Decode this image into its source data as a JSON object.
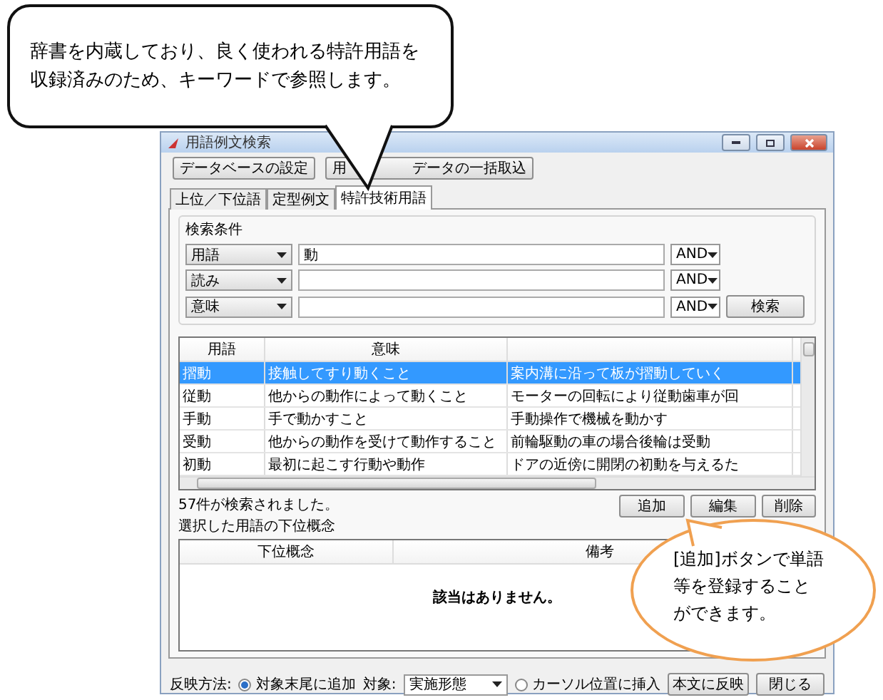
{
  "callouts": [
    {
      "kind": "speech",
      "lines": [
        "辞書を内蔵しており、良く使われる特許用語を",
        "収録済みのため、キーワードで参照します。"
      ]
    },
    {
      "kind": "bubble",
      "lines": [
        "[追加]ボタンで単語",
        "等を登録すること",
        "ができます。"
      ]
    }
  ],
  "window": {
    "title": "用語例文検索"
  },
  "toolbar": [
    {
      "parts": [
        "データベースの設定"
      ]
    },
    {
      "parts": [
        "用",
        "データの一括取込"
      ]
    }
  ],
  "tabs": [
    {
      "label": "上位／下位語",
      "selected": false
    },
    {
      "label": "定型例文",
      "selected": false
    },
    {
      "label": "特許技術用語",
      "selected": true
    }
  ],
  "search": {
    "title": "検索条件",
    "button": "検索",
    "rows": [
      {
        "field": "用語",
        "value": "動",
        "operator": "AND"
      },
      {
        "field": "読み",
        "value": "",
        "operator": "AND"
      },
      {
        "field": "意味",
        "value": "",
        "operator": "AND"
      }
    ]
  },
  "results": {
    "columns": [
      "用語",
      "意味"
    ],
    "rows": [
      {
        "cells": [
          "摺動",
          "接触してすり動くこと",
          "案内溝に沿って板が摺動していく"
        ],
        "selected": true
      },
      {
        "cells": [
          "従動",
          "他からの動作によって動くこと",
          "モーターの回転により従動歯車が回"
        ],
        "selected": false
      },
      {
        "cells": [
          "手動",
          "手で動かすこと",
          "手動操作で機械を動かす"
        ],
        "selected": false
      },
      {
        "cells": [
          "受動",
          "他からの動作を受けて動作すること",
          "前輪駆動の車の場合後輪は受動"
        ],
        "selected": false
      },
      {
        "cells": [
          "初動",
          "最初に起こす行動や動作",
          "ドアの近傍に開閉の初動を与えるた"
        ],
        "selected": false
      }
    ]
  },
  "status": "57件が検索されました。",
  "actions": [
    "追加",
    "編集",
    "削除"
  ],
  "sub_title": "選択した用語の下位概念",
  "sub_table": {
    "columns": [
      "下位概念",
      "備考"
    ],
    "empty": "該当はありません。"
  },
  "footer": {
    "label": "反映方法:",
    "options": [
      {
        "label": "対象末尾に追加",
        "selected": true
      },
      {
        "label": "カーソル位置に挿入",
        "selected": false
      }
    ],
    "target_label": "対象:",
    "target": "実施形態",
    "buttons": [
      "本文に反映",
      "閉じる"
    ]
  }
}
